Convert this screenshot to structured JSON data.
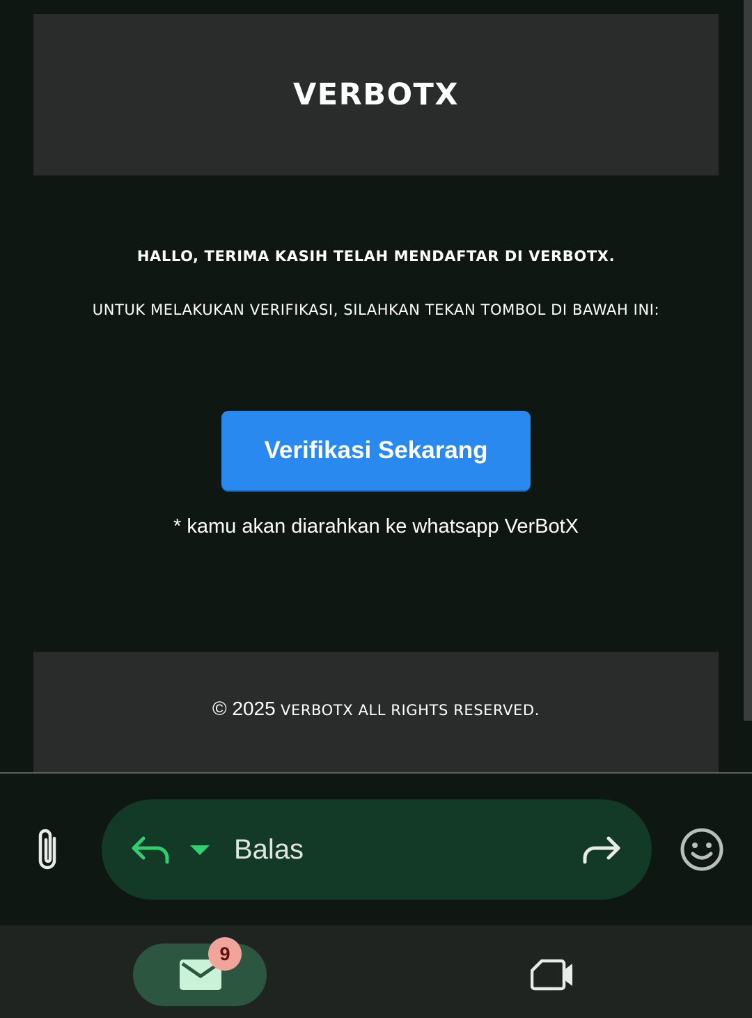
{
  "email": {
    "brand": "VERBOTX",
    "greeting": "HALLO, TERIMA KASIH TELAH MENDAFTAR DI VERBOTX.",
    "instruction": "UNTUK MELAKUKAN VERIFIKASI, SILAHKAN TEKAN TOMBOL DI BAWAH INI:",
    "verify_button": "Verifikasi Sekarang",
    "redirect_note": "* kamu akan diarahkan ke whatsapp VerBotX",
    "footer": {
      "copyright_year": "© 2025",
      "copyright_text": "VERBOTX ALL RIGHTS RESERVED."
    }
  },
  "reply_bar": {
    "placeholder": "Balas",
    "icons": [
      "paperclip-icon",
      "reply-icon",
      "dropdown-icon",
      "forward-icon",
      "emoji-icon"
    ]
  },
  "bottom_nav": {
    "mail_badge_count": "9",
    "icons": [
      "mail-icon",
      "video-icon"
    ]
  },
  "colors": {
    "background": "#0f1713",
    "card": "#2a2b2b",
    "button": "#2a89ef",
    "reply_pill": "#123a26",
    "accent_green": "#2fcf72",
    "badge": "#f1a49a"
  }
}
